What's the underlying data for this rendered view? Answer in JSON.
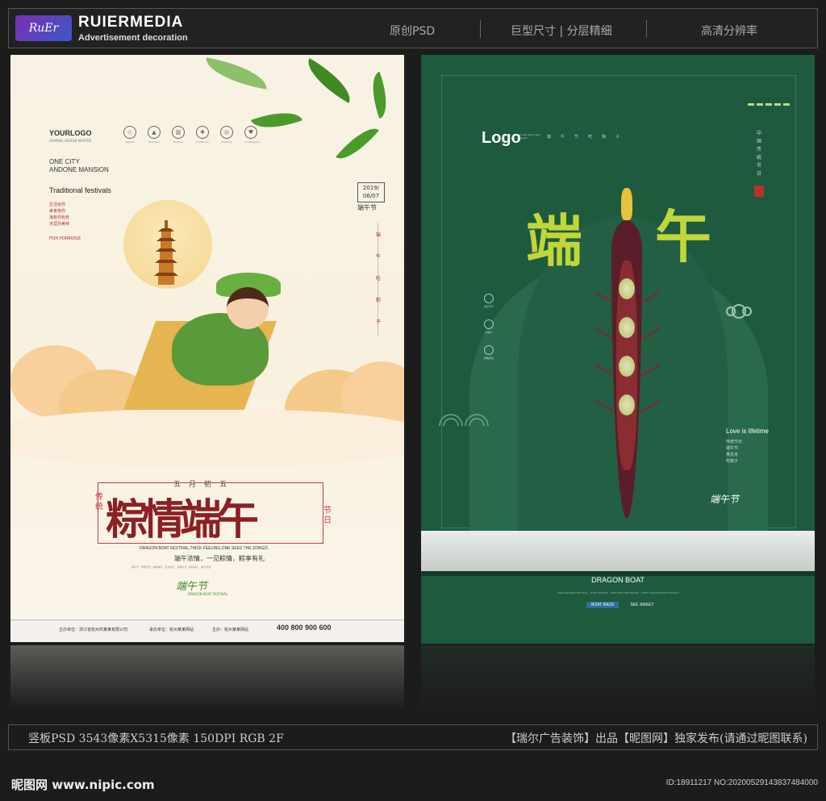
{
  "header": {
    "badge": "RuEr",
    "brand": "RUIERMEDIA",
    "brand_sub": "Advertisement decoration",
    "items": [
      "原创PSD",
      "巨型尺寸 | 分层精细",
      "高清分辨率"
    ]
  },
  "left_poster": {
    "logo": "YOURLOGO",
    "logo_sub": "GRAPHIC DESIGN MASTER",
    "icon_labels": [
      "Apparel",
      "Mountain",
      "Building",
      "Contractor",
      "Planning",
      "Kindergarten"
    ],
    "city_line1": "ONE CITY",
    "city_line2": "ANDONE MANSION",
    "traditional": "Traditional festivals",
    "red_lines": [
      "生活有你",
      "美食有你",
      "海有你有有",
      "天涯共美味"
    ],
    "fish": "FISH PORRIDGE",
    "date_line1": "2019/",
    "date_line2": "06/07",
    "dwj": "端午节",
    "vertical_chars": [
      "端",
      "午",
      "吃",
      "粽",
      "子"
    ],
    "calendar": [
      "五",
      "月",
      "初",
      "五"
    ],
    "title": "粽情端午",
    "chuan_tong": "传统",
    "jie_ri": "节日",
    "english": "DRAGON BOAT FESTIVAL,THICK FEELING,ONE SEES THE ZONGZI.",
    "subtitle": "端午浓情，一见粽情，粽享有礼",
    "tiny_text": "端午节 · 传统节日 · 粽情端午 · 五月初五 · 传承文化 · 粽享有礼 · 端午安康",
    "logo2": "端午节",
    "logo2_sub": "DRAGON BOAT FESTIVAL",
    "footer_items": [
      "主办单位：浙江省杭州市某某有限公司",
      "承办单位：杭州某某网站",
      "主办：杭州某某网站"
    ],
    "phone": "400 800 900 600"
  },
  "right_poster": {
    "logo": "Logo",
    "logo_small": "Your logo goes here company",
    "top_chars": [
      "端",
      "午",
      "节",
      "吃",
      "粽",
      "子"
    ],
    "vertical_title": "中国传统节日",
    "char_left": "端",
    "char_right": "午",
    "icon_labels": [
      "龙舟节日",
      "吃粽子",
      "佩戴香包"
    ],
    "love": "Love is lifetime",
    "love_lines": [
      "传统节日",
      "端午节",
      "赛龙舟",
      "吃粽子"
    ],
    "logo2": "端午节",
    "band_title": "DRAGON BOAT",
    "tiny_text": "DRAGON BOAT FESTIVAL · THICK FEELING · ONE SEES THE ZONGZI · HAPPY DRAGON BOAT FESTIVAL",
    "btn_race": "BOAT RACE",
    "btn_sweet": "SEE SWEET"
  },
  "footer": {
    "left": "竖板PSD 3543像素X5315像素 150DPI RGB 2F",
    "right": "【瑞尔广告装饰】出品【昵图网】独家发布(请通过昵图联系)",
    "site": "昵图网 www.nipic.com",
    "id": "ID:18911217 NO:20200529143837484000"
  }
}
